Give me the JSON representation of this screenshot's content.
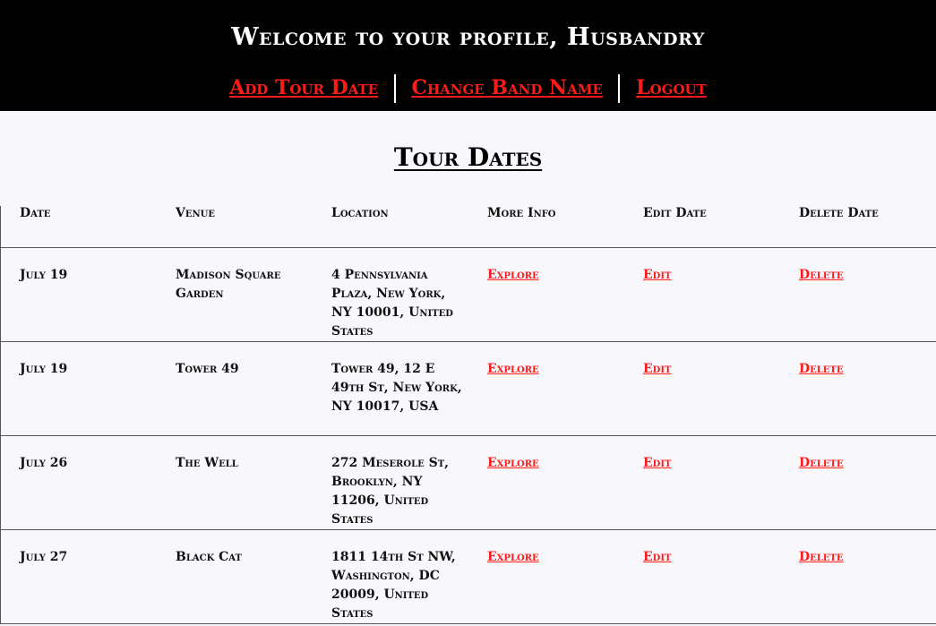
{
  "header": {
    "welcome": "Welcome to your profile, Husbandry",
    "nav": {
      "add_tour_date": "Add Tour Date",
      "change_band_name": "Change Band Name",
      "logout": "Logout"
    }
  },
  "main": {
    "title": "Tour Dates",
    "columns": [
      "Date",
      "Venue",
      "Location",
      "More Info",
      "Edit Date",
      "Delete Date"
    ],
    "rows": [
      {
        "date": "July 19",
        "venue": "Madison Square Garden",
        "location": "4 Pennsylvania Plaza, New York, NY 10001, United States",
        "more_info": "Explore",
        "edit": "Edit",
        "delete": "Delete"
      },
      {
        "date": "July 19",
        "venue": "Tower 49",
        "location": "Tower 49, 12 E 49th St, New York, NY 10017, USA",
        "more_info": "Explore",
        "edit": "Edit",
        "delete": "Delete"
      },
      {
        "date": "July 26",
        "venue": "The Well",
        "location": "272 Meserole St, Brooklyn, NY 11206, United States",
        "more_info": "Explore",
        "edit": "Edit",
        "delete": "Delete"
      },
      {
        "date": "July 27",
        "venue": "Black Cat",
        "location": "1811 14th St NW, Washington, DC 20009, United States",
        "more_info": "Explore",
        "edit": "Edit",
        "delete": "Delete"
      }
    ]
  },
  "colors": {
    "header_bg": "#000000",
    "link": "#ff1a1a",
    "page_bg": "#f8f8fc"
  }
}
